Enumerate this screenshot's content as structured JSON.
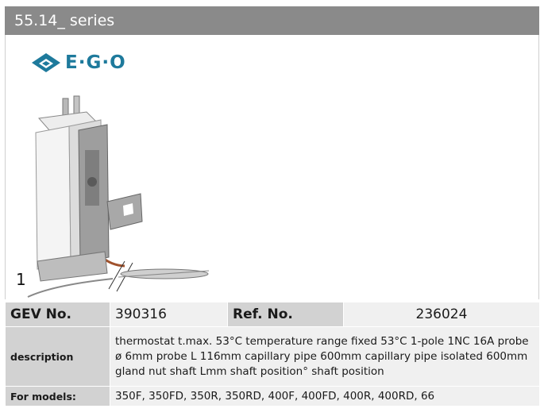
{
  "header": {
    "title": "55.14_ series"
  },
  "logo": {
    "text": "E·G·O"
  },
  "figure": {
    "position_number": "1"
  },
  "table": {
    "gev_label": "GEV No.",
    "gev_value": "390316",
    "ref_label": "Ref. No.",
    "ref_value": "236024",
    "description_label": "description",
    "description_value": "thermostat  t.max. 53°C temperature range fixed 53°C 1-pole 1NC 16A probe ø 6mm probe L 116mm capillary pipe 600mm capillary pipe isolated 600mm gland nut shaft Lmm shaft position° shaft position",
    "models_label": "For models:",
    "models_value": "350F, 350FD, 350R, 350RD, 400F, 400FD, 400R, 400RD, 66"
  },
  "colors": {
    "header_bg": "#8a8a8a",
    "label_bg": "#d2d2d2",
    "value_bg": "#f0f0f0",
    "logo": "#1e7a9c"
  }
}
